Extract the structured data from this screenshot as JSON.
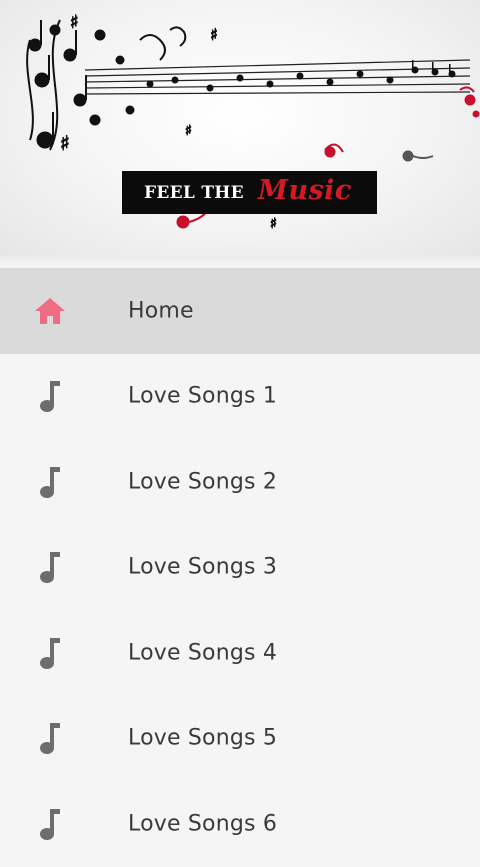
{
  "header": {
    "logo_text_left": "FEEL THE",
    "logo_text_right": "Music"
  },
  "menu": {
    "items": [
      {
        "label": "Home",
        "icon": "home-icon",
        "active": true
      },
      {
        "label": "Love Songs 1",
        "icon": "music-note-icon",
        "active": false
      },
      {
        "label": "Love Songs 2",
        "icon": "music-note-icon",
        "active": false
      },
      {
        "label": "Love Songs 3",
        "icon": "music-note-icon",
        "active": false
      },
      {
        "label": "Love Songs 4",
        "icon": "music-note-icon",
        "active": false
      },
      {
        "label": "Love Songs 5",
        "icon": "music-note-icon",
        "active": false
      },
      {
        "label": "Love Songs 6",
        "icon": "music-note-icon",
        "active": false
      }
    ]
  },
  "colors": {
    "accent_home_icon": "#f06b84",
    "note_icon": "#6d6d6d",
    "logo_red": "#d41a22",
    "active_row": "#dadada"
  }
}
